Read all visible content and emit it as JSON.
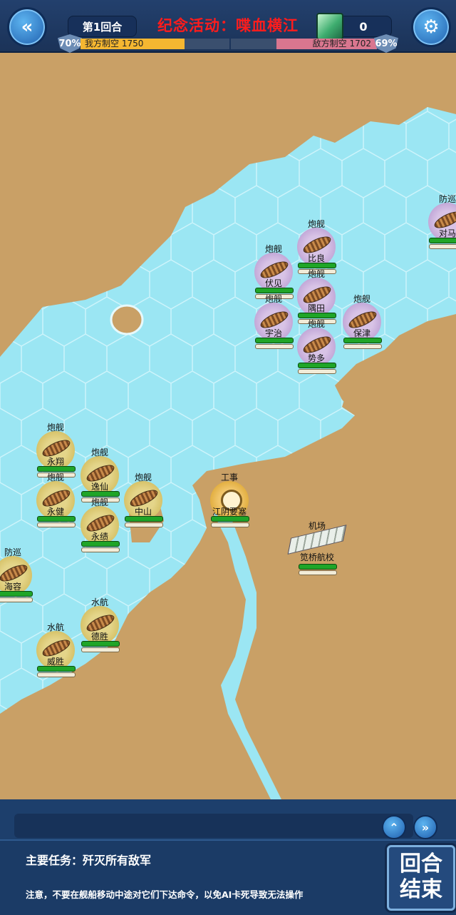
{
  "topbar": {
    "back_icon": "double-chevron-left-icon",
    "round_label": "第1回合",
    "event_title": "纪念活动：喋血横江",
    "gem_icon": "green-gem-icon",
    "gem_count": "0",
    "settings_icon": "gear-wrench-icon"
  },
  "air_control": {
    "ally_pct": "70%",
    "ally_label": "我方制空 1750",
    "ally_fraction": 0.7,
    "enemy_pct": "69%",
    "enemy_label": "敌方制空 1702",
    "enemy_fraction": 0.69
  },
  "units": [
    {
      "side": "ally",
      "type": "炮舰",
      "name": "永翔"
    },
    {
      "side": "ally",
      "type": "炮舰",
      "name": "逸仙"
    },
    {
      "side": "ally",
      "type": "炮舰",
      "name": "永健"
    },
    {
      "side": "ally",
      "type": "炮舰",
      "name": "中山"
    },
    {
      "side": "ally",
      "type": "炮舰",
      "name": "永绩"
    },
    {
      "side": "ally",
      "type": "防巡",
      "name": "海容"
    },
    {
      "side": "ally",
      "type": "水航",
      "name": "德胜"
    },
    {
      "side": "ally",
      "type": "水航",
      "name": "威胜"
    },
    {
      "side": "enemy",
      "type": "炮舰",
      "name": "比良"
    },
    {
      "side": "enemy",
      "type": "炮舰",
      "name": "伏见"
    },
    {
      "side": "enemy",
      "type": "炮舰",
      "name": "隅田"
    },
    {
      "side": "enemy",
      "type": "炮舰",
      "name": "宇治"
    },
    {
      "side": "enemy",
      "type": "炮舰",
      "name": "保津"
    },
    {
      "side": "enemy",
      "type": "炮舰",
      "name": "势多"
    },
    {
      "side": "enemy",
      "type": "防巡",
      "name": "对马"
    },
    {
      "side": "neutral",
      "type": "工事",
      "name": "江阴要塞"
    }
  ],
  "airfield": {
    "type": "机场",
    "name": "笕桥航校"
  },
  "bottom": {
    "up_icon": "double-chevron-up-icon",
    "forward_icon": "double-chevron-right-icon",
    "mission": "主要任务：歼灭所有敌军",
    "notice": "注意，不要在舰船移动中途对它们下达命令，以免AI卡死导致无法操作",
    "end_turn": "回合结束"
  },
  "colors": {
    "water": "#9be6f3",
    "land": "#c9a066",
    "hud": "#1d3f6c",
    "event_red": "#ff1c1c",
    "ally_bar": "#f5b731",
    "enemy_bar": "#d9768f"
  }
}
